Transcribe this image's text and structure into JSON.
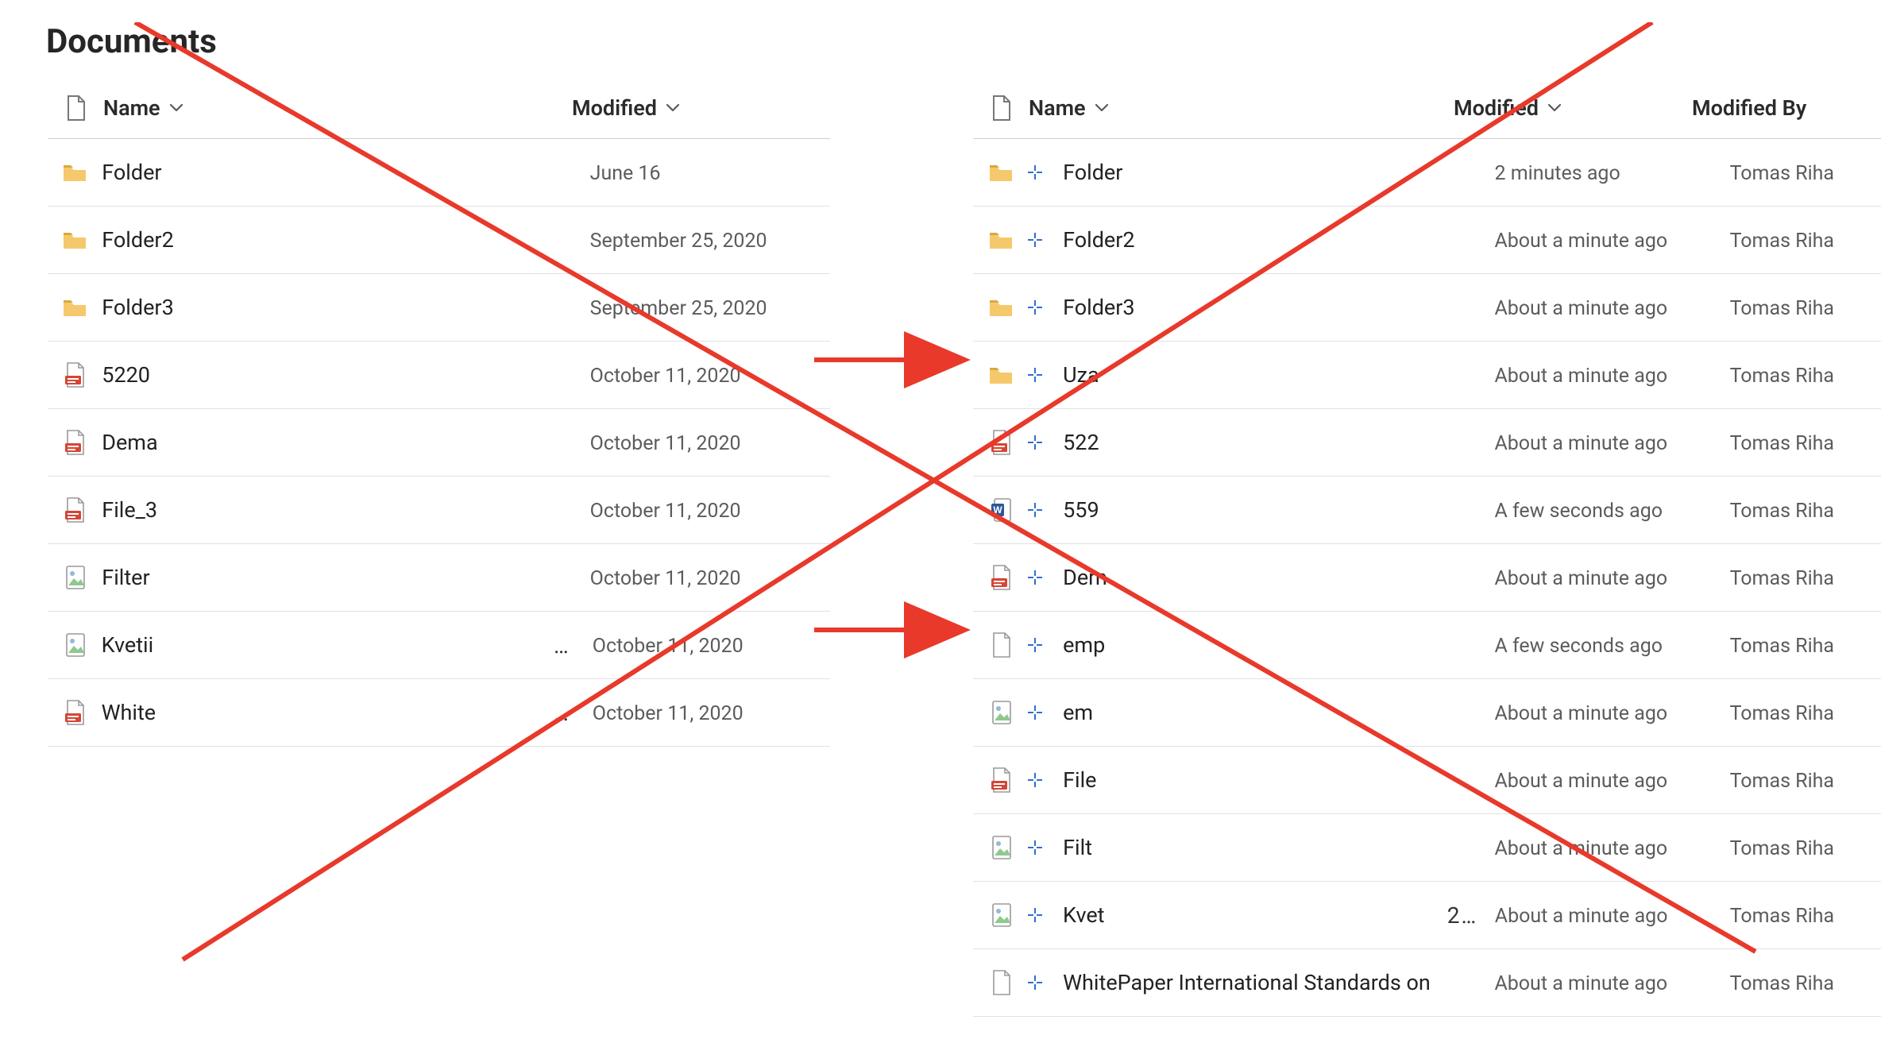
{
  "page_title": "Documents",
  "annotation": {
    "cross_color": "#e8392b",
    "arrow_color": "#e8392b"
  },
  "left": {
    "headers": {
      "name": "Name",
      "modified": "Modified"
    },
    "rows": [
      {
        "icon": "folder",
        "name": "Folder",
        "modified": "June 16",
        "ellipsis": false
      },
      {
        "icon": "folder",
        "name": "Folder2",
        "modified": "September 25, 2020",
        "ellipsis": false
      },
      {
        "icon": "folder",
        "name": "Folder3",
        "modified": "September 25, 2020",
        "ellipsis": false
      },
      {
        "icon": "pdf",
        "name": "5220",
        "modified": "October 11, 2020",
        "ellipsis": false
      },
      {
        "icon": "pdf",
        "name": "Dema",
        "modified": "October 11, 2020",
        "ellipsis": false
      },
      {
        "icon": "pdf",
        "name": "File_3",
        "modified": "October 11, 2020",
        "ellipsis": false
      },
      {
        "icon": "image",
        "name": "Filter",
        "modified": "October 11, 2020",
        "ellipsis": false
      },
      {
        "icon": "image",
        "name": "Kvetii",
        "modified": "October 11, 2020",
        "ellipsis": true
      },
      {
        "icon": "pdf",
        "name": "White",
        "modified": "October 11, 2020",
        "ellipsis": true
      }
    ]
  },
  "right": {
    "headers": {
      "name": "Name",
      "modified": "Modified",
      "by": "Modified By"
    },
    "rows": [
      {
        "icon": "folder",
        "new": true,
        "name": "Folder",
        "modified": "2 minutes ago",
        "by": "Tomas Riha",
        "ellipsis": false
      },
      {
        "icon": "folder",
        "new": true,
        "name": "Folder2",
        "modified": "About a minute ago",
        "by": "Tomas Riha",
        "ellipsis": false
      },
      {
        "icon": "folder",
        "new": true,
        "name": "Folder3",
        "modified": "About a minute ago",
        "by": "Tomas Riha",
        "ellipsis": false
      },
      {
        "icon": "folder",
        "new": true,
        "name": "Uza",
        "modified": "About a minute ago",
        "by": "Tomas Riha",
        "ellipsis": false
      },
      {
        "icon": "pdf",
        "new": true,
        "name": "522",
        "modified": "About a minute ago",
        "by": "Tomas Riha",
        "ellipsis": false
      },
      {
        "icon": "word",
        "new": true,
        "name": "559",
        "modified": "A few seconds ago",
        "by": "Tomas Riha",
        "ellipsis": false
      },
      {
        "icon": "pdf",
        "new": true,
        "name": "Dem",
        "modified": "About a minute ago",
        "by": "Tomas Riha",
        "ellipsis": false
      },
      {
        "icon": "generic",
        "new": true,
        "name": "emp",
        "modified": "A few seconds ago",
        "by": "Tomas Riha",
        "ellipsis": false
      },
      {
        "icon": "image",
        "new": true,
        "name": "em",
        "modified": "About a minute ago",
        "by": "Tomas Riha",
        "ellipsis": false
      },
      {
        "icon": "pdf",
        "new": true,
        "name": "File",
        "modified": "About a minute ago",
        "by": "Tomas Riha",
        "ellipsis": false
      },
      {
        "icon": "image",
        "new": true,
        "name": "Filt",
        "modified": "About a minute ago",
        "by": "Tomas Riha",
        "ellipsis": false
      },
      {
        "icon": "image",
        "new": true,
        "name": "Kvet",
        "modified": "About a minute ago",
        "by": "Tomas Riha",
        "ellipsis": true
      },
      {
        "icon": "generic",
        "new": true,
        "name": "WhitePaper International Standards on",
        "modified": "About a minute ago",
        "by": "Tomas Riha",
        "ellipsis": false
      }
    ]
  }
}
